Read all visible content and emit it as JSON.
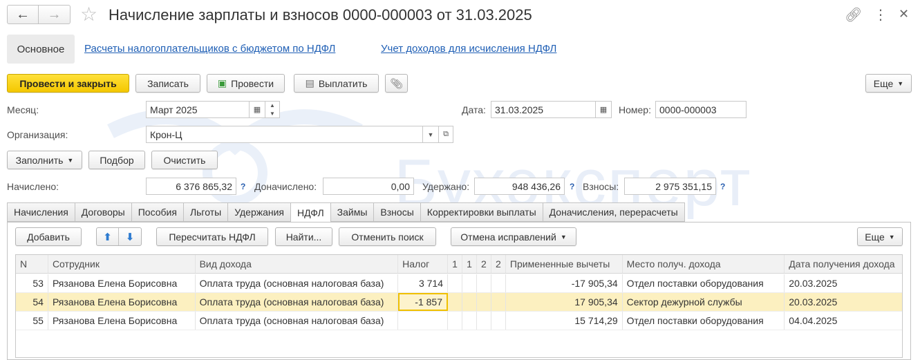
{
  "window": {
    "title": "Начисление зарплаты и взносов 0000-000003 от 31.03.2025"
  },
  "nav": {
    "tabs": [
      {
        "label": "Основное"
      },
      {
        "label": "Расчеты налогоплательщиков с бюджетом по НДФЛ"
      },
      {
        "label": "Учет доходов для исчисления НДФЛ"
      }
    ]
  },
  "toolbar": {
    "post_close": "Провести и закрыть",
    "save": "Записать",
    "post": "Провести",
    "pay": "Выплатить",
    "more": "Еще"
  },
  "form": {
    "month_label": "Месяц:",
    "month_value": "Март 2025",
    "date_label": "Дата:",
    "date_value": "31.03.2025",
    "number_label": "Номер:",
    "number_value": "0000-000003",
    "org_label": "Организация:",
    "org_value": "Крон-Ц"
  },
  "actions": {
    "fill": "Заполнить",
    "select": "Подбор",
    "clear": "Очистить"
  },
  "totals": {
    "accrued_label": "Начислено:",
    "accrued_value": "6 376 865,32",
    "extra_label": "Доначислено:",
    "extra_value": "0,00",
    "withheld_label": "Удержано:",
    "withheld_value": "948 436,26",
    "contrib_label": "Взносы:",
    "contrib_value": "2 975 351,15",
    "help": "?"
  },
  "doc_tabs": [
    {
      "label": "Начисления"
    },
    {
      "label": "Договоры"
    },
    {
      "label": "Пособия"
    },
    {
      "label": "Льготы"
    },
    {
      "label": "Удержания"
    },
    {
      "label": "НДФЛ"
    },
    {
      "label": "Займы"
    },
    {
      "label": "Взносы"
    },
    {
      "label": "Корректировки выплаты"
    },
    {
      "label": "Доначисления, перерасчеты"
    }
  ],
  "grid_toolbar": {
    "add": "Добавить",
    "recalc": "Пересчитать НДФЛ",
    "find": "Найти...",
    "cancel_search": "Отменить поиск",
    "cancel_fix": "Отмена исправлений",
    "more": "Еще"
  },
  "table": {
    "columns": [
      "N",
      "Сотрудник",
      "Вид дохода",
      "Налог",
      "1",
      "1",
      "2",
      "2",
      "Примененные вычеты",
      "Место получ. дохода",
      "Дата получения дохода"
    ],
    "rows": [
      {
        "n": "53",
        "employee": "Рязанова Елена Борисовна",
        "income": "Оплата труда (основная налоговая база)",
        "tax": "3 714",
        "deductions": "-17 905,34",
        "place": "Отдел поставки оборудования",
        "date": "20.03.2025"
      },
      {
        "n": "54",
        "employee": "Рязанова Елена Борисовна",
        "income": "Оплата труда (основная налоговая база)",
        "tax": "-1 857",
        "deductions": "17 905,34",
        "place": "Сектор дежурной службы",
        "date": "20.03.2025"
      },
      {
        "n": "55",
        "employee": "Рязанова Елена Борисовна",
        "income": "Оплата труда (основная налоговая база)",
        "tax": "",
        "deductions": "15 714,29",
        "place": "Отдел поставки оборудования",
        "date": "04.04.2025"
      }
    ]
  },
  "watermark": "Бухэксперт",
  "colors": {
    "primary_button": "#f4c800",
    "link": "#1f5fb5",
    "selected_row": "#fcf0c0",
    "selected_cell_border": "#f0c000"
  }
}
